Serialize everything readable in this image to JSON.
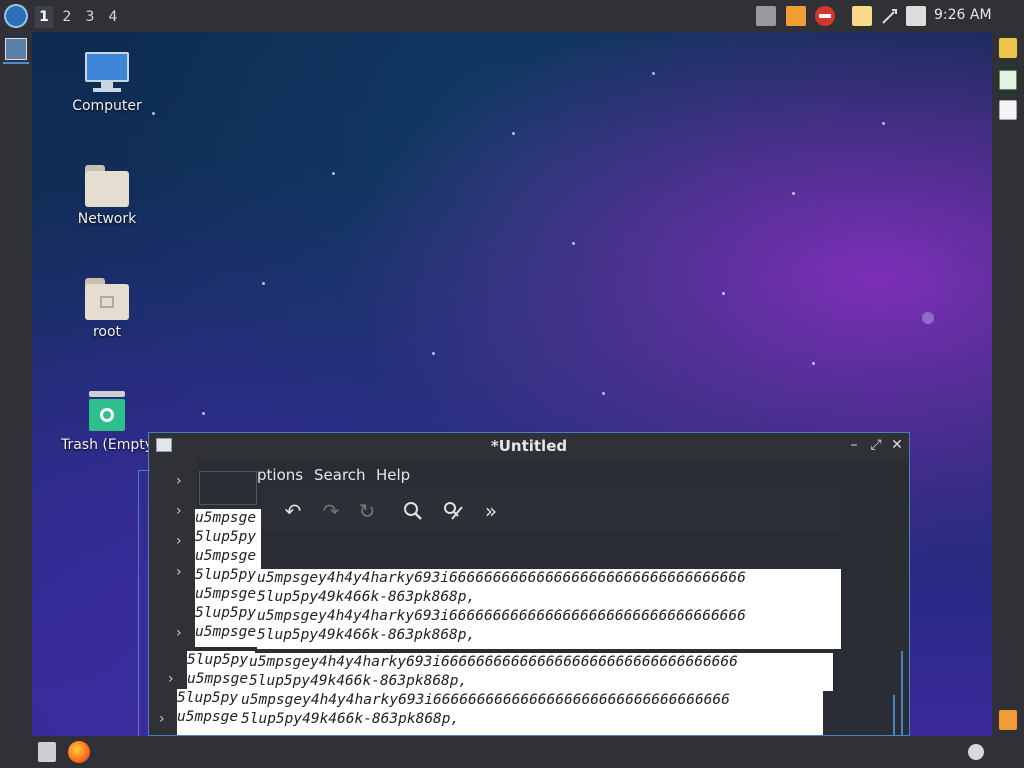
{
  "top_panel": {
    "workspaces": [
      "1",
      "2",
      "3",
      "4"
    ],
    "active_workspace": "1",
    "clock": "9:26 AM"
  },
  "desktop": {
    "icons": [
      {
        "label": "Computer"
      },
      {
        "label": "Network"
      },
      {
        "label": "root"
      },
      {
        "label": "Trash (Empty"
      }
    ]
  },
  "editor": {
    "title": "*Untitled",
    "menu": {
      "options": "ptions",
      "search": "Search",
      "help": "Help"
    },
    "lines": [
      "u5mpsgey4h4y4harky693i6666666666666666666666666666666666",
      "5lup5py49k466k-863pk868p,",
      "u5mpsgey4h4y4harky693i6666666666666666666666666666666666",
      "5lup5py49k466k-863pk868p,"
    ],
    "left_fragments": [
      "u5mpsge",
      "5lup5py",
      "u5mpsge",
      "5lup5py",
      "u5mpsge",
      "5lup5py",
      "u5mpsge",
      "5lup5py",
      "u5mpsge"
    ]
  },
  "colors": {
    "panel": "#2f3137",
    "accent": "#4a7fc0",
    "text_bg": "#ffffff"
  }
}
